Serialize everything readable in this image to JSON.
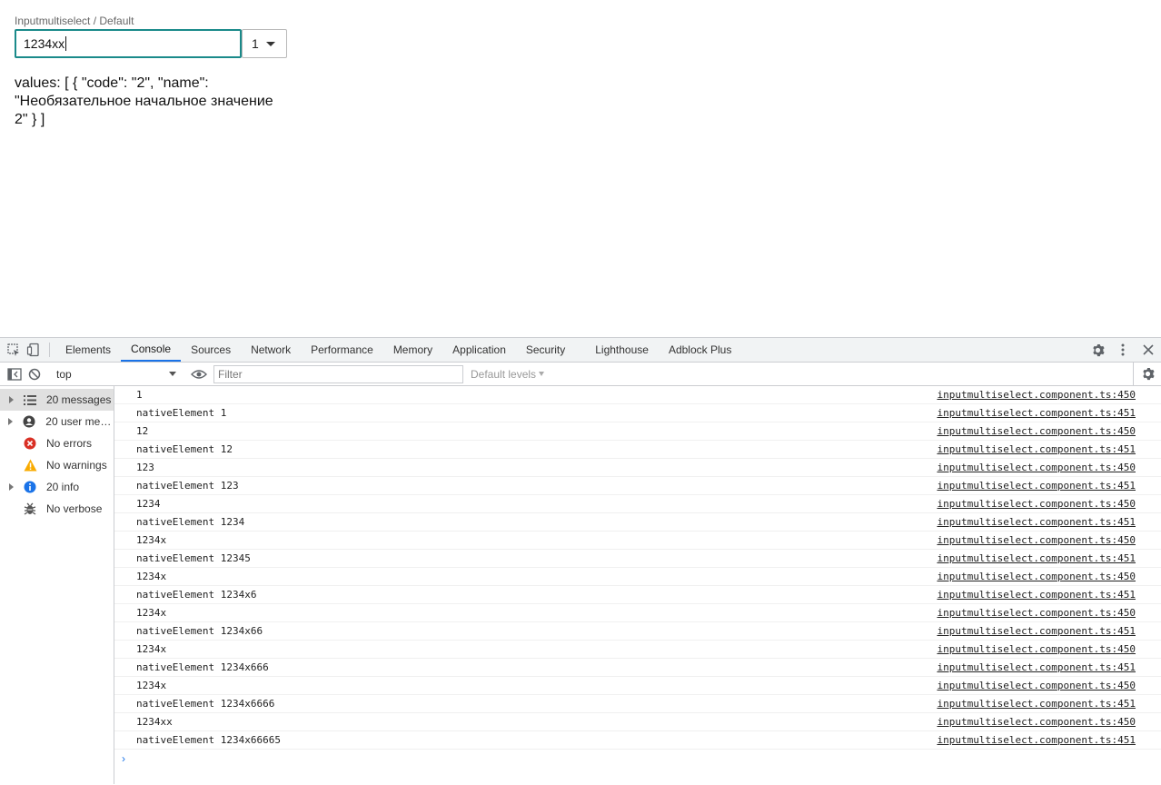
{
  "app": {
    "field_label": "Inputmultiselect / Default",
    "input_value": "1234xx",
    "count_value": "1",
    "values_text": "values: [ { \"code\": \"2\", \"name\":\n\"Необязательное начальное значение\n2\" } ]"
  },
  "devtools": {
    "tabs": [
      "Elements",
      "Console",
      "Sources",
      "Network",
      "Performance",
      "Memory",
      "Application",
      "Security",
      "Lighthouse",
      "Adblock Plus"
    ],
    "active_tab": "Console",
    "context": "top",
    "filter_placeholder": "Filter",
    "levels": "Default levels",
    "sidebar": [
      {
        "label": "20 messages",
        "icon": "list-icon",
        "expandable": true,
        "selected": true
      },
      {
        "label": "20 user mes...",
        "icon": "user-icon",
        "expandable": true,
        "selected": false
      },
      {
        "label": "No errors",
        "icon": "error-icon",
        "expandable": false,
        "selected": false
      },
      {
        "label": "No warnings",
        "icon": "warning-icon",
        "expandable": false,
        "selected": false
      },
      {
        "label": "20 info",
        "icon": "info-icon",
        "expandable": true,
        "selected": false
      },
      {
        "label": "No verbose",
        "icon": "bug-icon",
        "expandable": false,
        "selected": false
      }
    ],
    "logs": [
      {
        "text": "1",
        "source": "inputmultiselect.component.ts:450"
      },
      {
        "text": "nativeElement 1",
        "source": "inputmultiselect.component.ts:451"
      },
      {
        "text": "12",
        "source": "inputmultiselect.component.ts:450"
      },
      {
        "text": "nativeElement 12",
        "source": "inputmultiselect.component.ts:451"
      },
      {
        "text": "123",
        "source": "inputmultiselect.component.ts:450"
      },
      {
        "text": "nativeElement 123",
        "source": "inputmultiselect.component.ts:451"
      },
      {
        "text": "1234",
        "source": "inputmultiselect.component.ts:450"
      },
      {
        "text": "nativeElement 1234",
        "source": "inputmultiselect.component.ts:451"
      },
      {
        "text": "1234x",
        "source": "inputmultiselect.component.ts:450"
      },
      {
        "text": "nativeElement 12345",
        "source": "inputmultiselect.component.ts:451"
      },
      {
        "text": "1234x",
        "source": "inputmultiselect.component.ts:450"
      },
      {
        "text": "nativeElement 1234x6",
        "source": "inputmultiselect.component.ts:451"
      },
      {
        "text": "1234x",
        "source": "inputmultiselect.component.ts:450"
      },
      {
        "text": "nativeElement 1234x66",
        "source": "inputmultiselect.component.ts:451"
      },
      {
        "text": "1234x",
        "source": "inputmultiselect.component.ts:450"
      },
      {
        "text": "nativeElement 1234x666",
        "source": "inputmultiselect.component.ts:451"
      },
      {
        "text": "1234x",
        "source": "inputmultiselect.component.ts:450"
      },
      {
        "text": "nativeElement 1234x6666",
        "source": "inputmultiselect.component.ts:451"
      },
      {
        "text": "1234xx",
        "source": "inputmultiselect.component.ts:450"
      },
      {
        "text": "nativeElement 1234x66665",
        "source": "inputmultiselect.component.ts:451"
      }
    ],
    "prompt_symbol": "›"
  },
  "colors": {
    "input_border": "#1a8a8a",
    "active_tab_underline": "#1a73e8",
    "error": "#d93025",
    "warning": "#f9ab00",
    "info": "#1a73e8"
  }
}
